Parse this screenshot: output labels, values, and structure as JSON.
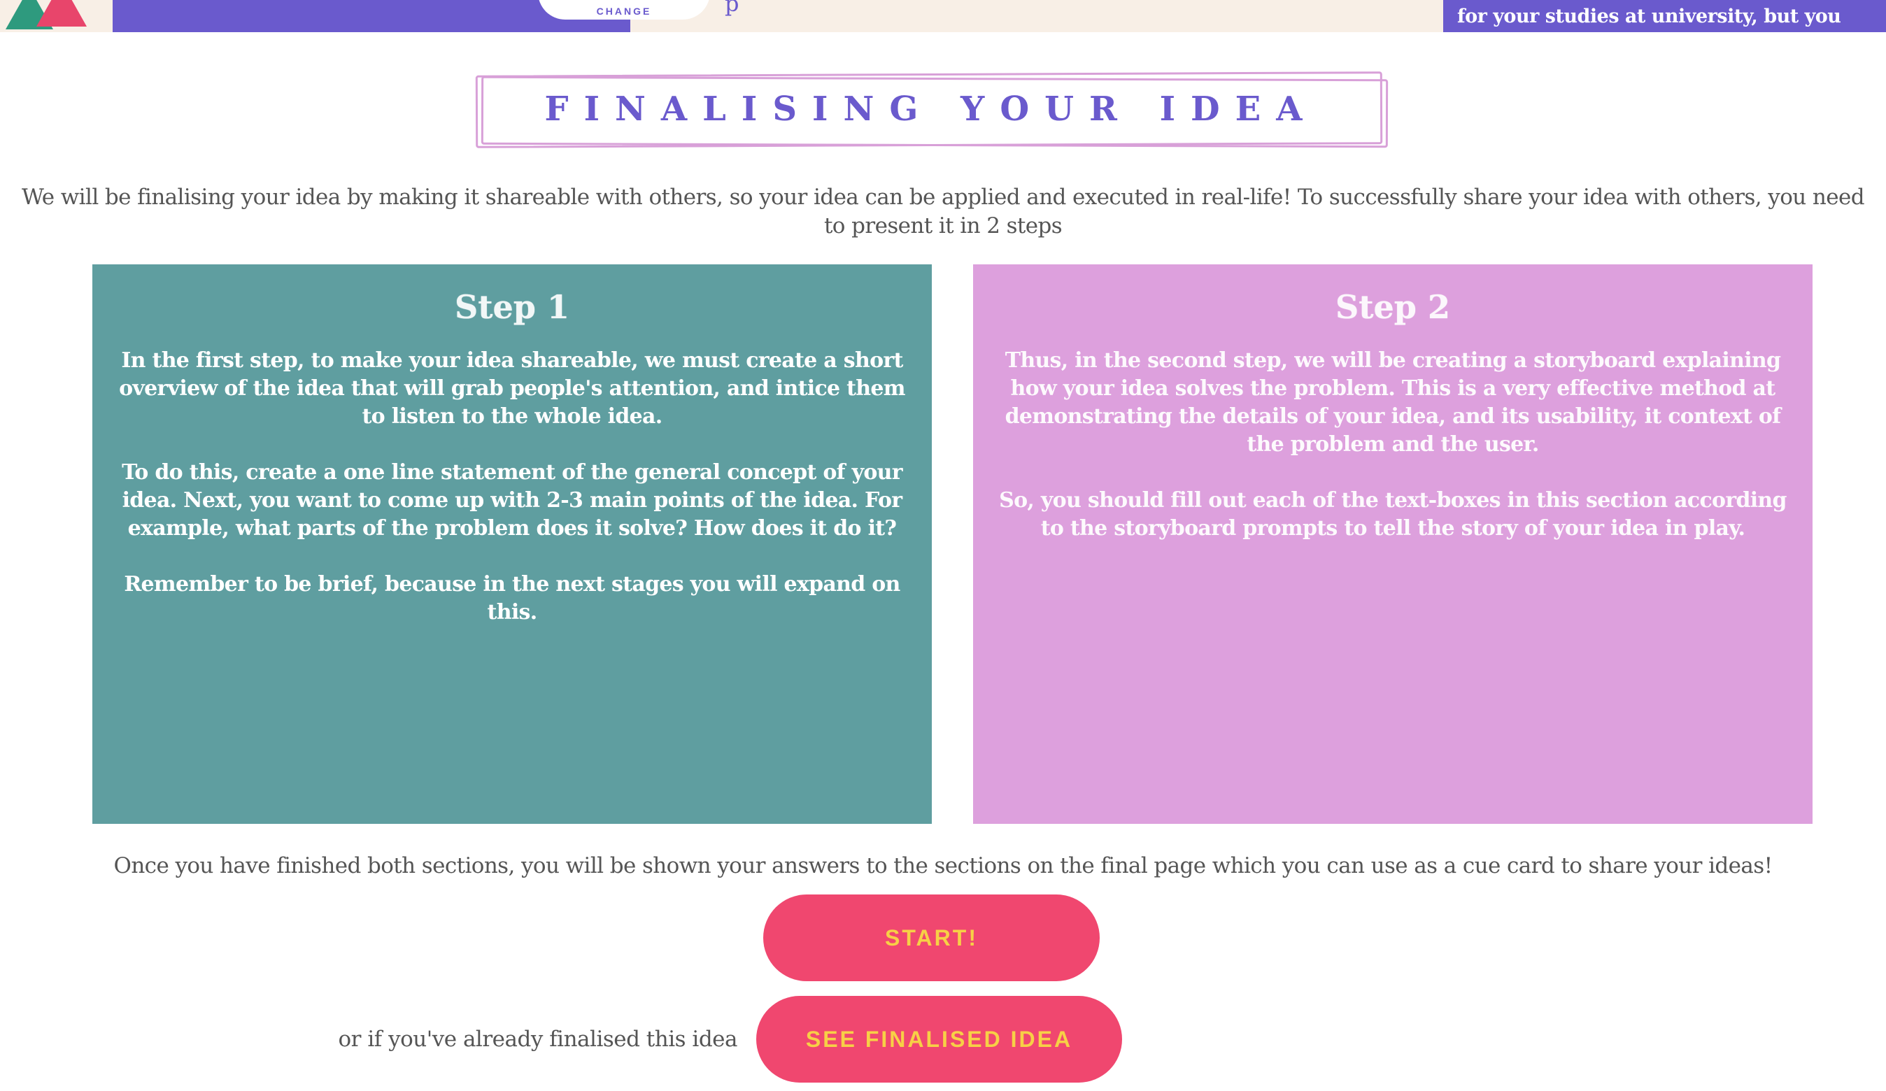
{
  "header": {
    "logo_icon": "brand-logo",
    "nav_button_label": "CHANGE",
    "cut_text": "p",
    "tooltip_line": "for your studies at university, but you"
  },
  "title": "Finalising your idea",
  "intro": "We will be finalising your idea by making it shareable with others, so your idea can be applied and executed in real-life! To successfully share your idea with others, you need to present it in 2 steps",
  "step1": {
    "title": "Step 1",
    "paragraphs": [
      "In the first step, to make your idea shareable, we must create a short overview of the idea that will grab people's attention, and intice them to listen to the whole idea.",
      "To do this, create a one line statement of the general concept of your idea. Next, you want to come up with 2-3 main points of the idea. For example, what parts of the problem does it solve? How does it do it?",
      "Remember to be brief, because in the next stages you will expand on this."
    ],
    "color": "#5f9ea0"
  },
  "step2": {
    "title": "Step 2",
    "paragraphs": [
      "Thus, in the second step, we will be creating a storyboard explaining how your idea solves the problem. This is a very effective method at demonstrating the details of your idea, and its usability, it context of the problem and the user.",
      "So, you should fill out each of the text-boxes in this section according to the storyboard prompts to tell the story of your idea in play."
    ],
    "color": "#dda0dd"
  },
  "outro": "Once you have finished both sections, you will be shown your answers to the sections on the final page which you can use as a cue card to share your ideas!",
  "buttons": {
    "start_label": "START!",
    "see_finalised_label": "SEE FINALISED IDEA",
    "already_text": "or if you've already finalised this idea"
  },
  "colors": {
    "brand_purple": "#6a5acd",
    "button_pink": "#f0476f",
    "button_text_yellow": "#f7d046",
    "header_cream": "#f8efe6"
  }
}
